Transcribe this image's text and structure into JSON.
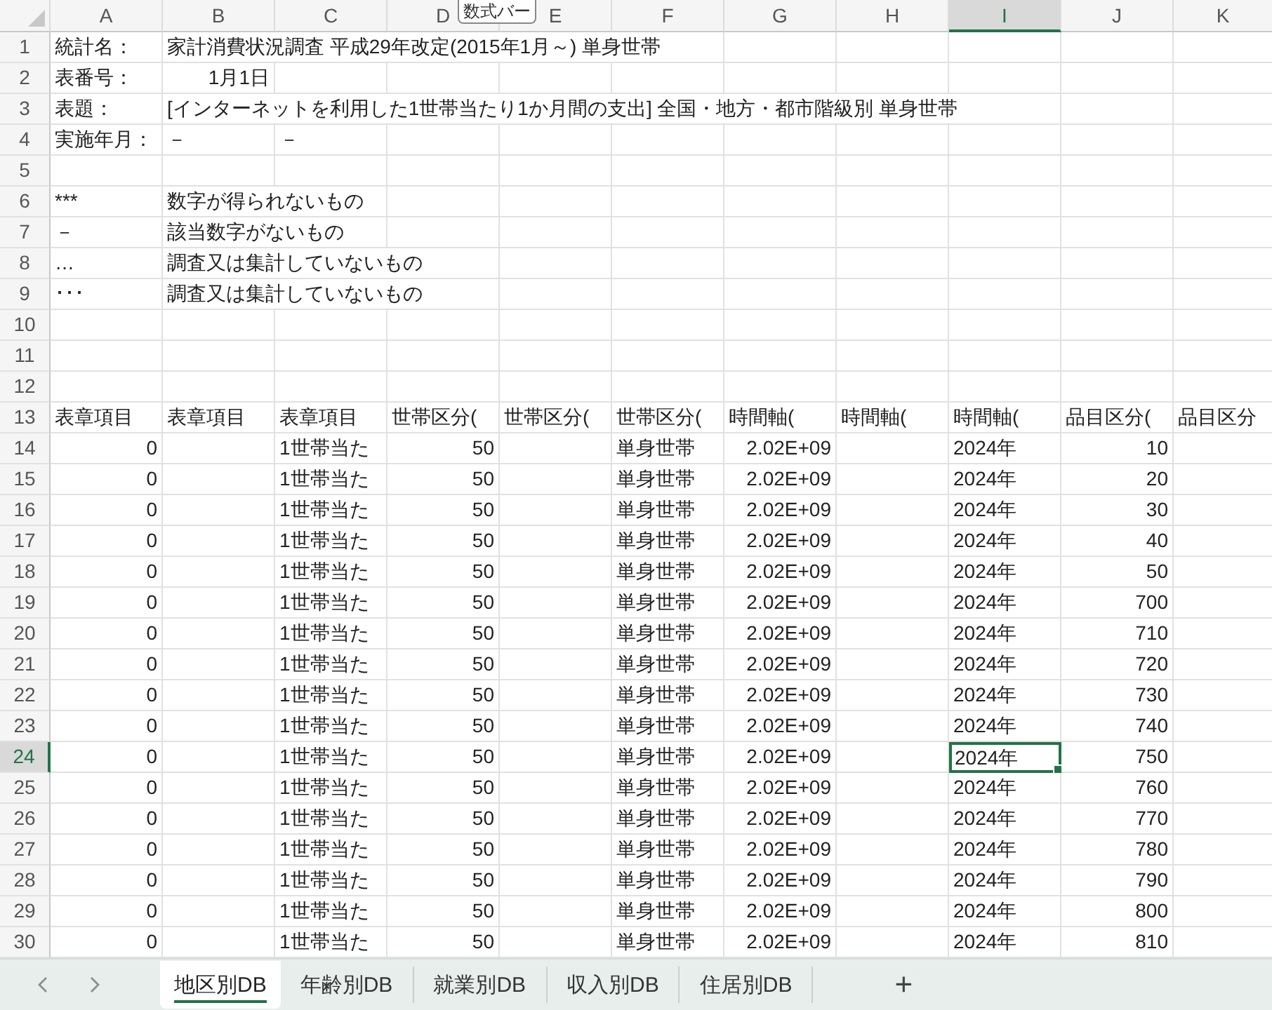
{
  "tooltip": {
    "text": "数式バー"
  },
  "columns": [
    "A",
    "B",
    "C",
    "D",
    "E",
    "F",
    "G",
    "H",
    "I",
    "J",
    "K"
  ],
  "rows": [
    {
      "number": "1",
      "cells": [
        {
          "text": "統計名：",
          "numeric": false,
          "selected": false
        },
        {
          "text": "家計消費状況調査 平成29年改定(2015年1月～) 単身世帯",
          "numeric": false,
          "selected": false
        },
        null,
        null,
        null,
        null,
        null,
        null,
        null,
        null,
        null
      ]
    },
    {
      "number": "2",
      "cells": [
        {
          "text": "表番号：",
          "numeric": false,
          "selected": false
        },
        {
          "text": "1月1日",
          "numeric": true,
          "selected": false
        },
        null,
        null,
        null,
        null,
        null,
        null,
        null,
        null,
        null
      ]
    },
    {
      "number": "3",
      "cells": [
        {
          "text": "表題：",
          "numeric": false,
          "selected": false
        },
        {
          "text": "[インターネットを利用した1世帯当たり1か月間の支出] 全国・地方・都市階級別 単身世帯",
          "numeric": false,
          "selected": false
        },
        null,
        null,
        null,
        null,
        null,
        null,
        null,
        null,
        null
      ]
    },
    {
      "number": "4",
      "cells": [
        {
          "text": "実施年月：",
          "numeric": false,
          "selected": false
        },
        {
          "text": "－",
          "numeric": false,
          "selected": false
        },
        {
          "text": "－",
          "numeric": false,
          "selected": false
        },
        null,
        null,
        null,
        null,
        null,
        null,
        null,
        null
      ]
    },
    {
      "number": "5"
    },
    {
      "number": "6",
      "cells": [
        {
          "text": "***",
          "numeric": false,
          "selected": false
        },
        {
          "text": "数字が得られないもの",
          "numeric": false,
          "selected": false
        },
        null,
        null,
        null,
        null,
        null,
        null,
        null,
        null,
        null
      ]
    },
    {
      "number": "7",
      "cells": [
        {
          "text": "－",
          "numeric": false,
          "selected": false
        },
        {
          "text": "該当数字がないもの",
          "numeric": false,
          "selected": false
        },
        null,
        null,
        null,
        null,
        null,
        null,
        null,
        null,
        null
      ]
    },
    {
      "number": "8",
      "cells": [
        {
          "text": "…",
          "numeric": false,
          "selected": false
        },
        {
          "text": "調査又は集計していないもの",
          "numeric": false,
          "selected": false
        },
        null,
        null,
        null,
        null,
        null,
        null,
        null,
        null,
        null
      ]
    },
    {
      "number": "9",
      "cells": [
        {
          "text": "･･･",
          "numeric": false,
          "selected": false
        },
        {
          "text": "調査又は集計していないもの",
          "numeric": false,
          "selected": false
        },
        null,
        null,
        null,
        null,
        null,
        null,
        null,
        null,
        null
      ]
    },
    {
      "number": "10"
    },
    {
      "number": "11"
    },
    {
      "number": "12"
    },
    {
      "number": "13",
      "cells": [
        {
          "text": "表章項目",
          "numeric": false,
          "selected": false
        },
        {
          "text": "表章項目",
          "numeric": false,
          "selected": false
        },
        {
          "text": "表章項目",
          "numeric": false,
          "selected": false
        },
        {
          "text": "世帯区分(",
          "numeric": false,
          "selected": false
        },
        {
          "text": "世帯区分(",
          "numeric": false,
          "selected": false
        },
        {
          "text": "世帯区分(",
          "numeric": false,
          "selected": false
        },
        {
          "text": "時間軸(",
          "numeric": false,
          "selected": false
        },
        {
          "text": "時間軸(",
          "numeric": false,
          "selected": false
        },
        {
          "text": "時間軸(",
          "numeric": false,
          "selected": false
        },
        {
          "text": "品目区分(",
          "numeric": false,
          "selected": false
        },
        {
          "text": "品目区分",
          "numeric": false,
          "selected": false
        }
      ]
    },
    {
      "number": "14",
      "cells": [
        {
          "text": "0",
          "numeric": true,
          "selected": false
        },
        null,
        {
          "text": "1世帯当た",
          "numeric": false,
          "selected": false
        },
        {
          "text": "50",
          "numeric": true,
          "selected": false
        },
        null,
        {
          "text": "単身世帯",
          "numeric": false,
          "selected": false
        },
        {
          "text": "2.02E+09",
          "numeric": true,
          "selected": false
        },
        null,
        {
          "text": "2024年",
          "numeric": false,
          "selected": false
        },
        {
          "text": "10",
          "numeric": true,
          "selected": false
        },
        null
      ]
    },
    {
      "number": "15",
      "cells": [
        {
          "text": "0",
          "numeric": true,
          "selected": false
        },
        null,
        {
          "text": "1世帯当た",
          "numeric": false,
          "selected": false
        },
        {
          "text": "50",
          "numeric": true,
          "selected": false
        },
        null,
        {
          "text": "単身世帯",
          "numeric": false,
          "selected": false
        },
        {
          "text": "2.02E+09",
          "numeric": true,
          "selected": false
        },
        null,
        {
          "text": "2024年",
          "numeric": false,
          "selected": false
        },
        {
          "text": "20",
          "numeric": true,
          "selected": false
        },
        null
      ]
    },
    {
      "number": "16",
      "cells": [
        {
          "text": "0",
          "numeric": true,
          "selected": false
        },
        null,
        {
          "text": "1世帯当た",
          "numeric": false,
          "selected": false
        },
        {
          "text": "50",
          "numeric": true,
          "selected": false
        },
        null,
        {
          "text": "単身世帯",
          "numeric": false,
          "selected": false
        },
        {
          "text": "2.02E+09",
          "numeric": true,
          "selected": false
        },
        null,
        {
          "text": "2024年",
          "numeric": false,
          "selected": false
        },
        {
          "text": "30",
          "numeric": true,
          "selected": false
        },
        null
      ]
    },
    {
      "number": "17",
      "cells": [
        {
          "text": "0",
          "numeric": true,
          "selected": false
        },
        null,
        {
          "text": "1世帯当た",
          "numeric": false,
          "selected": false
        },
        {
          "text": "50",
          "numeric": true,
          "selected": false
        },
        null,
        {
          "text": "単身世帯",
          "numeric": false,
          "selected": false
        },
        {
          "text": "2.02E+09",
          "numeric": true,
          "selected": false
        },
        null,
        {
          "text": "2024年",
          "numeric": false,
          "selected": false
        },
        {
          "text": "40",
          "numeric": true,
          "selected": false
        },
        null
      ]
    },
    {
      "number": "18",
      "cells": [
        {
          "text": "0",
          "numeric": true,
          "selected": false
        },
        null,
        {
          "text": "1世帯当た",
          "numeric": false,
          "selected": false
        },
        {
          "text": "50",
          "numeric": true,
          "selected": false
        },
        null,
        {
          "text": "単身世帯",
          "numeric": false,
          "selected": false
        },
        {
          "text": "2.02E+09",
          "numeric": true,
          "selected": false
        },
        null,
        {
          "text": "2024年",
          "numeric": false,
          "selected": false
        },
        {
          "text": "50",
          "numeric": true,
          "selected": false
        },
        null
      ]
    },
    {
      "number": "19",
      "cells": [
        {
          "text": "0",
          "numeric": true,
          "selected": false
        },
        null,
        {
          "text": "1世帯当た",
          "numeric": false,
          "selected": false
        },
        {
          "text": "50",
          "numeric": true,
          "selected": false
        },
        null,
        {
          "text": "単身世帯",
          "numeric": false,
          "selected": false
        },
        {
          "text": "2.02E+09",
          "numeric": true,
          "selected": false
        },
        null,
        {
          "text": "2024年",
          "numeric": false,
          "selected": false
        },
        {
          "text": "700",
          "numeric": true,
          "selected": false
        },
        null
      ]
    },
    {
      "number": "20",
      "cells": [
        {
          "text": "0",
          "numeric": true,
          "selected": false
        },
        null,
        {
          "text": "1世帯当た",
          "numeric": false,
          "selected": false
        },
        {
          "text": "50",
          "numeric": true,
          "selected": false
        },
        null,
        {
          "text": "単身世帯",
          "numeric": false,
          "selected": false
        },
        {
          "text": "2.02E+09",
          "numeric": true,
          "selected": false
        },
        null,
        {
          "text": "2024年",
          "numeric": false,
          "selected": false
        },
        {
          "text": "710",
          "numeric": true,
          "selected": false
        },
        null
      ]
    },
    {
      "number": "21",
      "cells": [
        {
          "text": "0",
          "numeric": true,
          "selected": false
        },
        null,
        {
          "text": "1世帯当た",
          "numeric": false,
          "selected": false
        },
        {
          "text": "50",
          "numeric": true,
          "selected": false
        },
        null,
        {
          "text": "単身世帯",
          "numeric": false,
          "selected": false
        },
        {
          "text": "2.02E+09",
          "numeric": true,
          "selected": false
        },
        null,
        {
          "text": "2024年",
          "numeric": false,
          "selected": false
        },
        {
          "text": "720",
          "numeric": true,
          "selected": false
        },
        null
      ]
    },
    {
      "number": "22",
      "cells": [
        {
          "text": "0",
          "numeric": true,
          "selected": false
        },
        null,
        {
          "text": "1世帯当た",
          "numeric": false,
          "selected": false
        },
        {
          "text": "50",
          "numeric": true,
          "selected": false
        },
        null,
        {
          "text": "単身世帯",
          "numeric": false,
          "selected": false
        },
        {
          "text": "2.02E+09",
          "numeric": true,
          "selected": false
        },
        null,
        {
          "text": "2024年",
          "numeric": false,
          "selected": false
        },
        {
          "text": "730",
          "numeric": true,
          "selected": false
        },
        null
      ]
    },
    {
      "number": "23",
      "cells": [
        {
          "text": "0",
          "numeric": true,
          "selected": false
        },
        null,
        {
          "text": "1世帯当た",
          "numeric": false,
          "selected": false
        },
        {
          "text": "50",
          "numeric": true,
          "selected": false
        },
        null,
        {
          "text": "単身世帯",
          "numeric": false,
          "selected": false
        },
        {
          "text": "2.02E+09",
          "numeric": true,
          "selected": false
        },
        null,
        {
          "text": "2024年",
          "numeric": false,
          "selected": false
        },
        {
          "text": "740",
          "numeric": true,
          "selected": false
        },
        null
      ]
    },
    {
      "number": "24",
      "cells": [
        {
          "text": "0",
          "numeric": true,
          "selected": false
        },
        null,
        {
          "text": "1世帯当た",
          "numeric": false,
          "selected": false
        },
        {
          "text": "50",
          "numeric": true,
          "selected": false
        },
        null,
        {
          "text": "単身世帯",
          "numeric": false,
          "selected": false
        },
        {
          "text": "2.02E+09",
          "numeric": true,
          "selected": false
        },
        null,
        {
          "text": "2024年",
          "numeric": false,
          "selected": true
        },
        {
          "text": "750",
          "numeric": true,
          "selected": false
        },
        null
      ]
    },
    {
      "number": "25",
      "cells": [
        {
          "text": "0",
          "numeric": true,
          "selected": false
        },
        null,
        {
          "text": "1世帯当た",
          "numeric": false,
          "selected": false
        },
        {
          "text": "50",
          "numeric": true,
          "selected": false
        },
        null,
        {
          "text": "単身世帯",
          "numeric": false,
          "selected": false
        },
        {
          "text": "2.02E+09",
          "numeric": true,
          "selected": false
        },
        null,
        {
          "text": "2024年",
          "numeric": false,
          "selected": false
        },
        {
          "text": "760",
          "numeric": true,
          "selected": false
        },
        null
      ]
    },
    {
      "number": "26",
      "cells": [
        {
          "text": "0",
          "numeric": true,
          "selected": false
        },
        null,
        {
          "text": "1世帯当た",
          "numeric": false,
          "selected": false
        },
        {
          "text": "50",
          "numeric": true,
          "selected": false
        },
        null,
        {
          "text": "単身世帯",
          "numeric": false,
          "selected": false
        },
        {
          "text": "2.02E+09",
          "numeric": true,
          "selected": false
        },
        null,
        {
          "text": "2024年",
          "numeric": false,
          "selected": false
        },
        {
          "text": "770",
          "numeric": true,
          "selected": false
        },
        null
      ]
    },
    {
      "number": "27",
      "cells": [
        {
          "text": "0",
          "numeric": true,
          "selected": false
        },
        null,
        {
          "text": "1世帯当た",
          "numeric": false,
          "selected": false
        },
        {
          "text": "50",
          "numeric": true,
          "selected": false
        },
        null,
        {
          "text": "単身世帯",
          "numeric": false,
          "selected": false
        },
        {
          "text": "2.02E+09",
          "numeric": true,
          "selected": false
        },
        null,
        {
          "text": "2024年",
          "numeric": false,
          "selected": false
        },
        {
          "text": "780",
          "numeric": true,
          "selected": false
        },
        null
      ]
    },
    {
      "number": "28",
      "cells": [
        {
          "text": "0",
          "numeric": true,
          "selected": false
        },
        null,
        {
          "text": "1世帯当た",
          "numeric": false,
          "selected": false
        },
        {
          "text": "50",
          "numeric": true,
          "selected": false
        },
        null,
        {
          "text": "単身世帯",
          "numeric": false,
          "selected": false
        },
        {
          "text": "2.02E+09",
          "numeric": true,
          "selected": false
        },
        null,
        {
          "text": "2024年",
          "numeric": false,
          "selected": false
        },
        {
          "text": "790",
          "numeric": true,
          "selected": false
        },
        null
      ]
    },
    {
      "number": "29",
      "cells": [
        {
          "text": "0",
          "numeric": true,
          "selected": false
        },
        null,
        {
          "text": "1世帯当た",
          "numeric": false,
          "selected": false
        },
        {
          "text": "50",
          "numeric": true,
          "selected": false
        },
        null,
        {
          "text": "単身世帯",
          "numeric": false,
          "selected": false
        },
        {
          "text": "2.02E+09",
          "numeric": true,
          "selected": false
        },
        null,
        {
          "text": "2024年",
          "numeric": false,
          "selected": false
        },
        {
          "text": "800",
          "numeric": true,
          "selected": false
        },
        null
      ]
    },
    {
      "number": "30",
      "cells": [
        {
          "text": "0",
          "numeric": true,
          "selected": false
        },
        null,
        {
          "text": "1世帯当た",
          "numeric": false,
          "selected": false
        },
        {
          "text": "50",
          "numeric": true,
          "selected": false
        },
        null,
        {
          "text": "単身世帯",
          "numeric": false,
          "selected": false
        },
        {
          "text": "2.02E+09",
          "numeric": true,
          "selected": false
        },
        null,
        {
          "text": "2024年",
          "numeric": false,
          "selected": false
        },
        {
          "text": "810",
          "numeric": true,
          "selected": false
        },
        null
      ]
    }
  ],
  "sheet_tabs": [
    {
      "label": "地区別DB",
      "selected": true
    },
    {
      "label": "年齢別DB",
      "selected": false
    },
    {
      "label": "就業別DB",
      "selected": false
    },
    {
      "label": "収入別DB",
      "selected": false
    },
    {
      "label": "住居別DB",
      "selected": false
    }
  ],
  "add_sheet": "+"
}
